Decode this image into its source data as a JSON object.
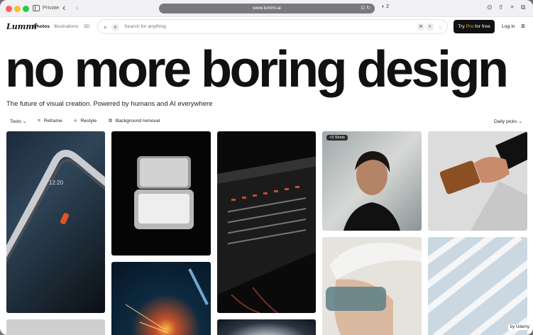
{
  "browser": {
    "private_label": "Private",
    "url": "www.lummi.ai",
    "url_icons": "⊡ ↻",
    "shield": "◐ 2"
  },
  "header": {
    "logo": "Lummi",
    "tabs": [
      {
        "label": "Photos",
        "active": true
      },
      {
        "label": "Illustrations",
        "active": false
      },
      {
        "label": "3D",
        "active": false
      }
    ],
    "search_placeholder": "Search for anything",
    "shortcut_keys": [
      "⌘",
      "K"
    ],
    "pro_button_prefix": "Try ",
    "pro_button_accent": "Pro",
    "pro_button_suffix": " for free",
    "login_label": "Log in"
  },
  "hero": {
    "title": "no more boring design",
    "subtitle": "The future of visual creation. Powered by humans and AI everywhere"
  },
  "toolbar": {
    "tools_label": "Tools",
    "reframe_label": "Reframe",
    "restyle_label": "Restyle",
    "bg_removal_label": "Background removal",
    "sort_label": "Daily picks"
  },
  "grid": {
    "shots_badge": "+5 Shots",
    "watermark": "by Udemy"
  },
  "colors": {
    "accent": "#f5a524",
    "primary_button": "#111111"
  }
}
